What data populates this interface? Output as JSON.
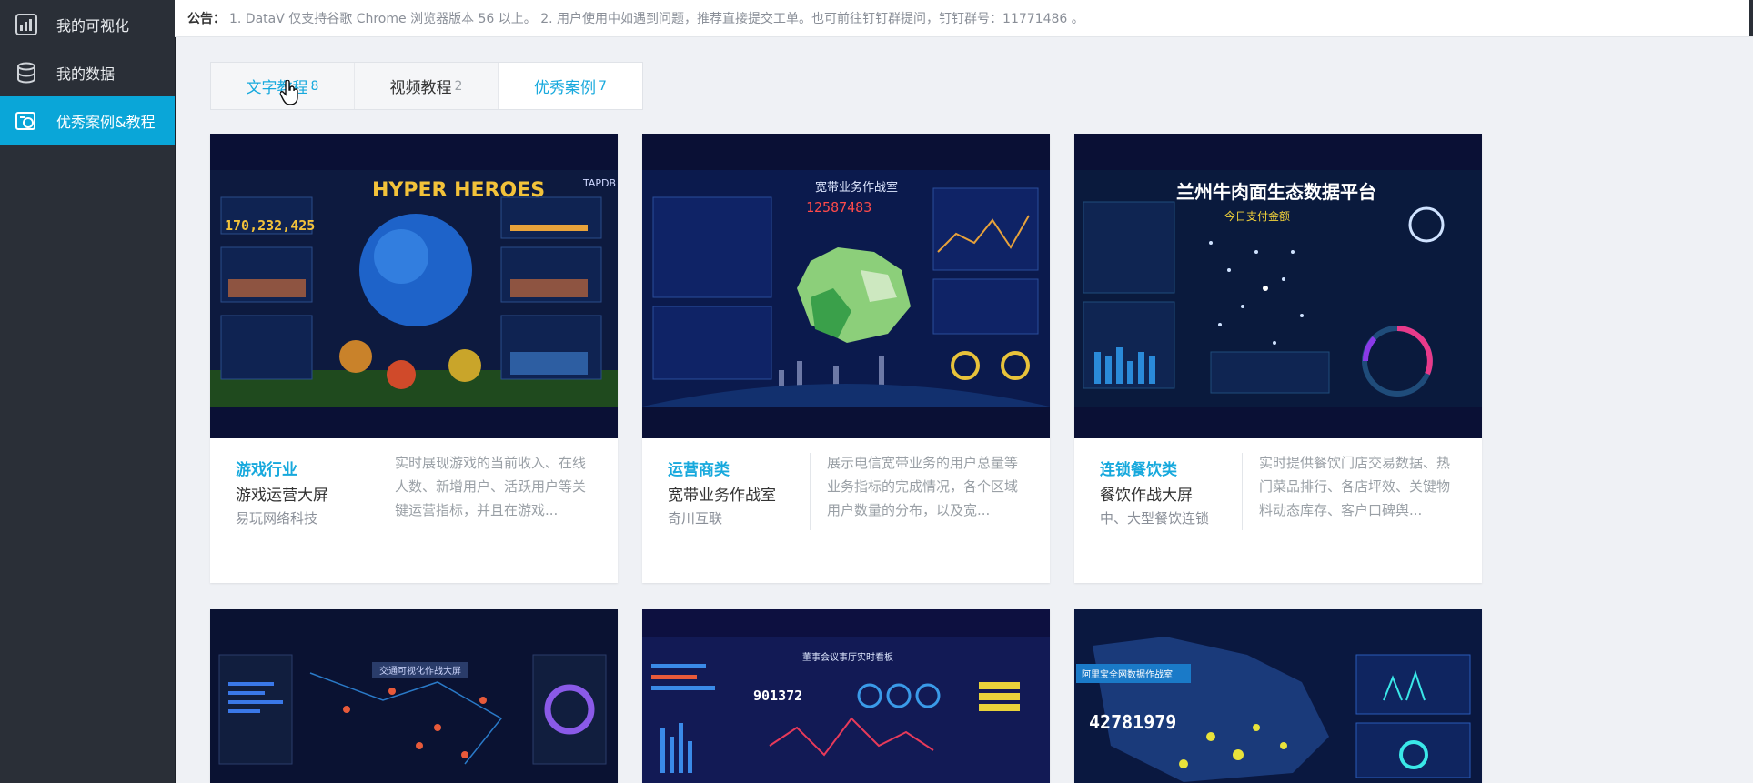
{
  "sidebar": {
    "items": [
      {
        "label": "我的可视化",
        "icon": "dashboard-icon"
      },
      {
        "label": "我的数据",
        "icon": "database-icon"
      },
      {
        "label": "优秀案例&教程",
        "icon": "cases-icon"
      }
    ],
    "active_index": 2
  },
  "notice": {
    "label": "公告：",
    "text": "1. DataV 仅支持谷歌 Chrome 浏览器版本 56 以上。 2. 用户使用中如遇到问题，推荐直接提交工单。也可前往钉钉群提问，钉钉群号：11771486 。"
  },
  "tabs": [
    {
      "label": "文字教程",
      "count": "8"
    },
    {
      "label": "视频教程",
      "count": "2"
    },
    {
      "label": "优秀案例",
      "count": "7"
    }
  ],
  "cards": [
    {
      "category": "游戏行业",
      "name": "游戏运营大屏",
      "org": "易玩网络科技",
      "desc": "实时展现游戏的当前收入、在线人数、新增用户、活跃用户等关键运营指标，并且在游戏...",
      "thumb": {
        "brand": "TAPDB",
        "logo": "HYPER HEROES",
        "metric": "170,232,425"
      }
    },
    {
      "category": "运营商类",
      "name": "宽带业务作战室",
      "org": "奇川互联",
      "desc": "展示电信宽带业务的用户总量等业务指标的完成情况，各个区域用户数量的分布，以及宽...",
      "thumb": {
        "title": "宽带业务作战室",
        "metric": "12587483"
      }
    },
    {
      "category": "连锁餐饮类",
      "name": "餐饮作战大屏",
      "org": "中、大型餐饮连锁",
      "desc": "实时提供餐饮门店交易数据、热门菜品排行、各店坪效、关键物料动态库存、客户口碑舆...",
      "thumb": {
        "title": "兰州牛肉面生态数据平台",
        "subtitle": "今日支付金额"
      }
    },
    {
      "thumb": {
        "title": "交通可视化作战大屏"
      }
    },
    {
      "thumb": {
        "title": "董事会议事厅实时看板",
        "metric": "901372"
      }
    },
    {
      "thumb": {
        "title": "阿里宝全网数据作战室",
        "metric": "42781979"
      }
    }
  ],
  "colors": {
    "accent": "#17a9dd",
    "sidebar_bg": "#2a2f37",
    "page_bg": "#eff1f5",
    "thumb_bg": "#0a1035"
  }
}
